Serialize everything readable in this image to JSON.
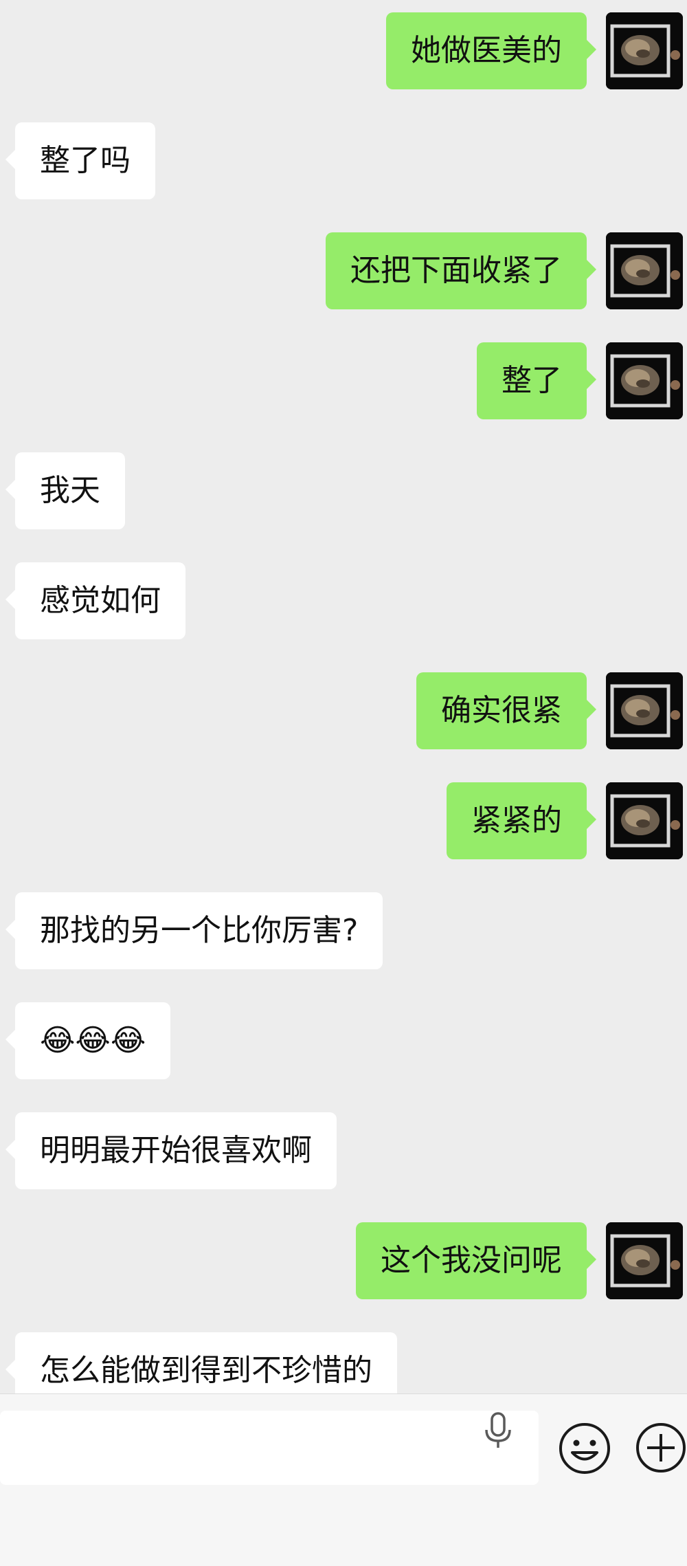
{
  "messages": [
    {
      "side": "out",
      "text": "她做医美的"
    },
    {
      "side": "in",
      "text": "整了吗"
    },
    {
      "side": "out",
      "text": "还把下面收紧了"
    },
    {
      "side": "out",
      "text": "整了"
    },
    {
      "side": "in",
      "text": "我天"
    },
    {
      "side": "in",
      "text": "感觉如何"
    },
    {
      "side": "out",
      "text": "确实很紧"
    },
    {
      "side": "out",
      "text": "紧紧的"
    },
    {
      "side": "in",
      "text": "那找的另一个比你厉害?"
    },
    {
      "side": "in",
      "text": "😂😂😂"
    },
    {
      "side": "in",
      "text": "明明最开始很喜欢啊"
    },
    {
      "side": "out",
      "text": "这个我没问呢"
    },
    {
      "side": "in",
      "text": "怎么能做到得到不珍惜的"
    }
  ],
  "input_bar": {
    "text_field_value": "",
    "icons": [
      "microphone-icon",
      "emoji-icon",
      "plus-icon"
    ]
  },
  "colors": {
    "background": "#ededed",
    "outgoing_bubble": "#95ec69",
    "incoming_bubble": "#ffffff",
    "icon_stroke": "#1a1a1a"
  }
}
